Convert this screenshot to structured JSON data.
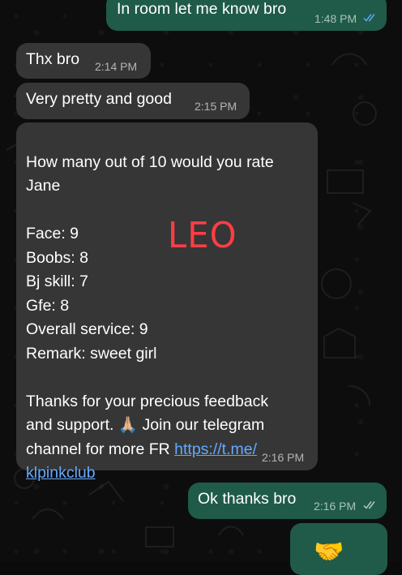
{
  "messages": [
    {
      "text": "In room let me know bro",
      "time": "1:48 PM"
    },
    {
      "text": "Thx bro",
      "time": "2:14 PM"
    },
    {
      "text": "Very pretty and good",
      "time": "2:15 PM"
    },
    {
      "text": "How many out of 10 would you rate\nJane\n\nFace: 9\nBoobs: 8\nBj skill: 7\nGfe: 8\nOverall service: 9\nRemark: sweet girl\n\nThanks for your precious feedback\nand support. 🙏🏼 Join our telegram\nchannel for more FR ",
      "link": "https://t.me/\nklpinkclub",
      "time": "2:16 PM"
    },
    {
      "text": "Ok thanks bro",
      "time": "2:16 PM"
    },
    {
      "emoji": "🤝"
    }
  ],
  "overlay_text": "LEO",
  "colors": {
    "incoming_bubble": "#363636",
    "outgoing_bubble": "#1f5b48",
    "read_ticks": "#58a7ff",
    "sent_ticks": "#b8c7c1",
    "overlay": "#ff3d43"
  },
  "icons": {
    "read": "double-check-icon",
    "delivered": "double-check-icon"
  }
}
